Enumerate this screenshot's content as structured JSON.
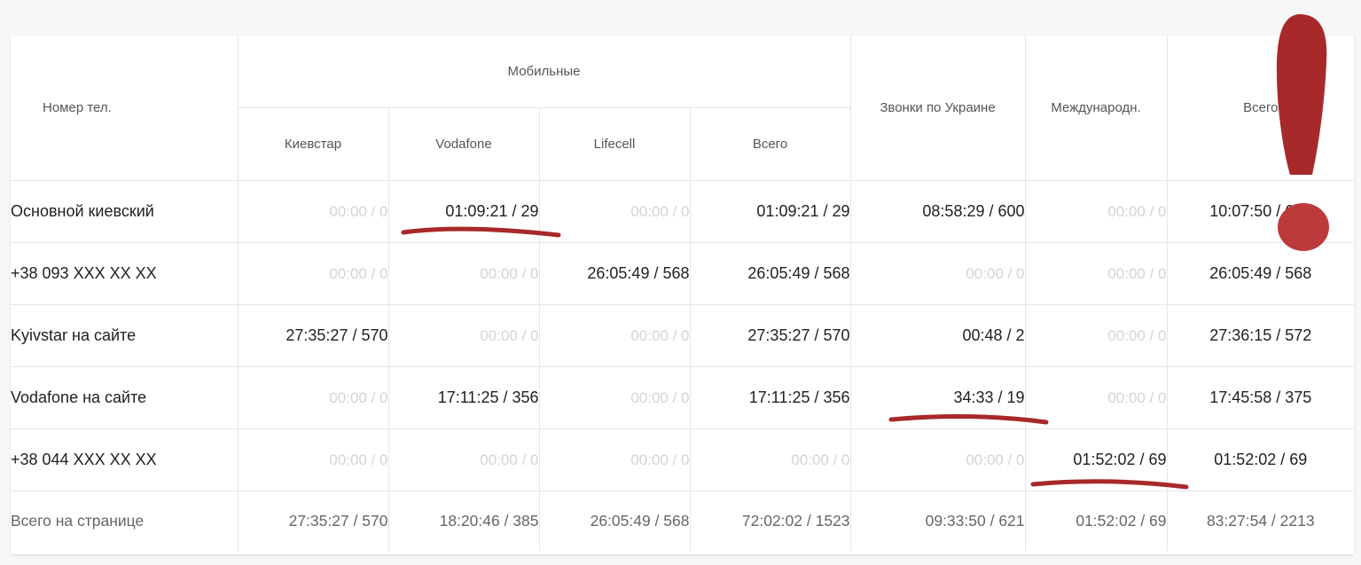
{
  "headers": {
    "phone": "Номер тел.",
    "mobile_group": "Мобильные",
    "kyivstar": "Киевстар",
    "vodafone": "Vodafone",
    "lifecell": "Lifecell",
    "mobile_total": "Всего",
    "ukraine": "Звонки по Украине",
    "international": "Международн.",
    "total": "Всего"
  },
  "rows": [
    {
      "name": "Основной киевский",
      "kyivstar": "00:00 / 0",
      "vodafone": "01:09:21 / 29",
      "lifecell": "00:00 / 0",
      "mobile_total": "01:09:21 / 29",
      "ukraine": "08:58:29 / 600",
      "international": "00:00 / 0",
      "total": "10:07:50 / 629"
    },
    {
      "name": "+38 093 XXX XX XX",
      "kyivstar": "00:00 / 0",
      "vodafone": "00:00 / 0",
      "lifecell": "26:05:49 / 568",
      "mobile_total": "26:05:49 / 568",
      "ukraine": "00:00 / 0",
      "international": "00:00 / 0",
      "total": "26:05:49 / 568"
    },
    {
      "name": "Kyivstar на сайте",
      "kyivstar": "27:35:27 / 570",
      "vodafone": "00:00 / 0",
      "lifecell": "00:00 / 0",
      "mobile_total": "27:35:27 / 570",
      "ukraine": "00:48 / 2",
      "international": "00:00 / 0",
      "total": "27:36:15 / 572"
    },
    {
      "name": "Vodafone на сайте",
      "kyivstar": "00:00 / 0",
      "vodafone": "17:11:25 / 356",
      "lifecell": "00:00 / 0",
      "mobile_total": "17:11:25 / 356",
      "ukraine": "34:33 / 19",
      "international": "00:00 / 0",
      "total": "17:45:58 / 375"
    },
    {
      "name": "+38 044 XXX XX XX",
      "kyivstar": "00:00 / 0",
      "vodafone": "00:00 / 0",
      "lifecell": "00:00 / 0",
      "mobile_total": "00:00 / 0",
      "ukraine": "00:00 / 0",
      "international": "01:52:02 / 69",
      "total": "01:52:02 / 69"
    }
  ],
  "totals": {
    "name": "Всего на странице",
    "kyivstar": "27:35:27 / 570",
    "vodafone": "18:20:46 / 385",
    "lifecell": "26:05:49 / 568",
    "mobile_total": "72:02:02 / 1523",
    "ukraine": "09:33:50 / 621",
    "international": "01:52:02 / 69",
    "total": "83:27:54 / 2213"
  },
  "colors": {
    "annotation": "#a8292a",
    "zero_value": "#d4d4d4",
    "text": "#212121"
  }
}
